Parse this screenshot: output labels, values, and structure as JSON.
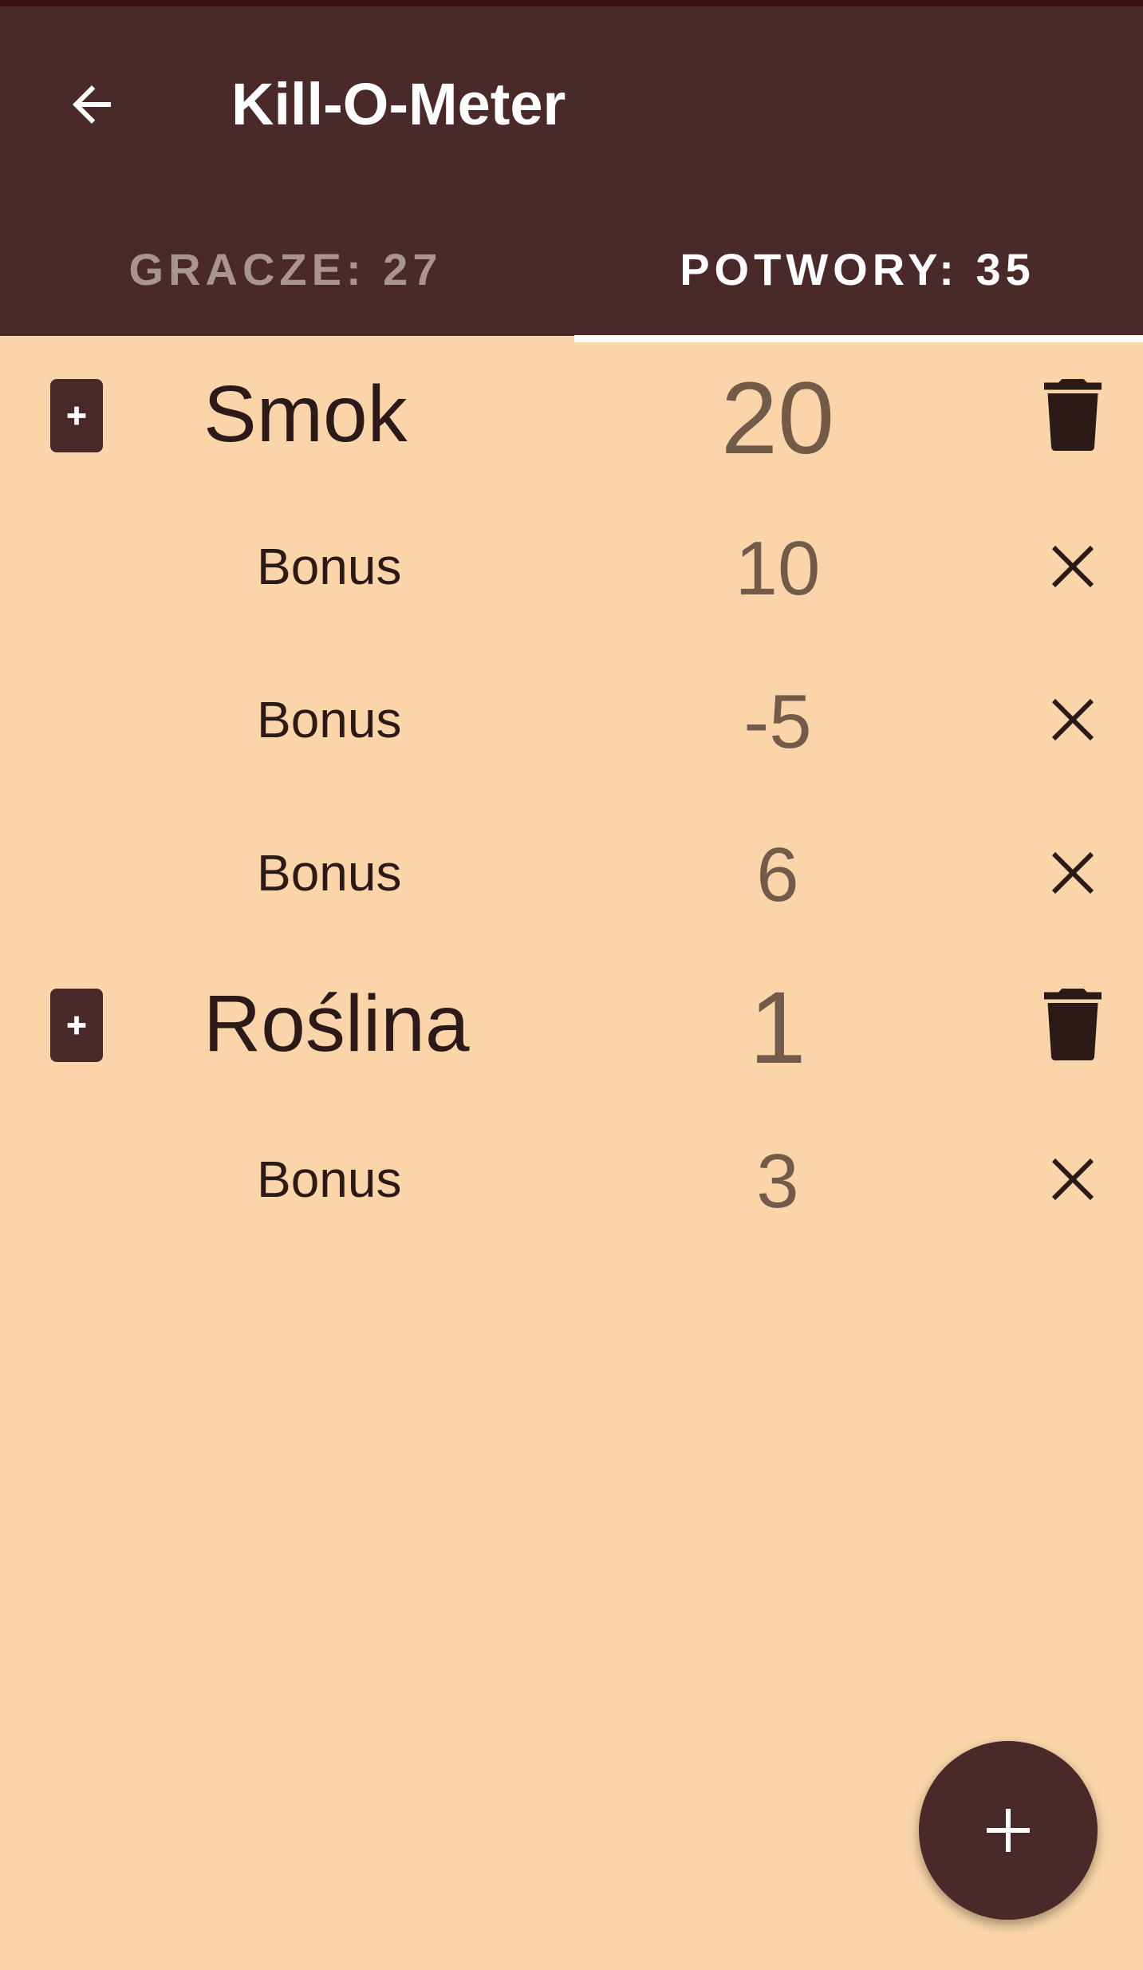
{
  "app": {
    "title": "Kill-O-Meter",
    "colors": {
      "appbar": "#4A2A28",
      "background": "#F9D5A9",
      "accent_text": "#735B4A",
      "text": "#2B1A18"
    }
  },
  "tabs": [
    {
      "label": "GRACZE: 27",
      "active": false
    },
    {
      "label": "POTWORY: 35",
      "active": true
    }
  ],
  "monsters": [
    {
      "name": "Smok",
      "value": "20",
      "bonuses": [
        {
          "label": "Bonus",
          "value": "10"
        },
        {
          "label": "Bonus",
          "value": "-5"
        },
        {
          "label": "Bonus",
          "value": "6"
        }
      ]
    },
    {
      "name": "Roślina",
      "value": "1",
      "bonuses": [
        {
          "label": "Bonus",
          "value": "3"
        }
      ]
    }
  ],
  "icons": {
    "back": "arrow-left-icon",
    "add_bonus": "card-plus-icon",
    "delete_monster": "trash-icon",
    "remove_bonus": "close-icon",
    "fab": "plus-icon"
  }
}
